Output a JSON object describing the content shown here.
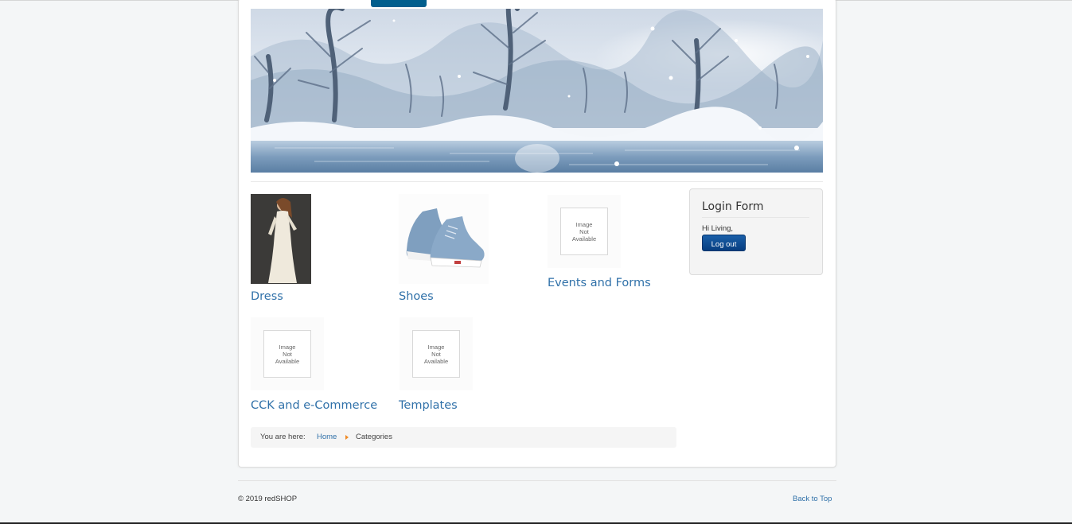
{
  "categories": [
    {
      "name": "Dress",
      "image": "dress-photo"
    },
    {
      "name": "Shoes",
      "image": "shoes-photo"
    },
    {
      "name": "Events and Forms",
      "image": "no-image"
    },
    {
      "name": "CCK and e-Commerce",
      "image": "no-image"
    },
    {
      "name": "Templates",
      "image": "no-image"
    }
  ],
  "no_image_text": {
    "line1": "Image",
    "line2": "Not",
    "line3": "Available"
  },
  "login": {
    "title": "Login Form",
    "greeting": "Hi Living,",
    "logout_label": "Log out"
  },
  "breadcrumb": {
    "prefix": "You are here:",
    "home": "Home",
    "current": "Categories"
  },
  "footer": {
    "copyright": "© 2019 redSHOP",
    "back_to_top": "Back to Top"
  },
  "colors": {
    "link": "#3071a9",
    "button": "#0a4a8f",
    "accent_arrow": "#f08a24"
  }
}
